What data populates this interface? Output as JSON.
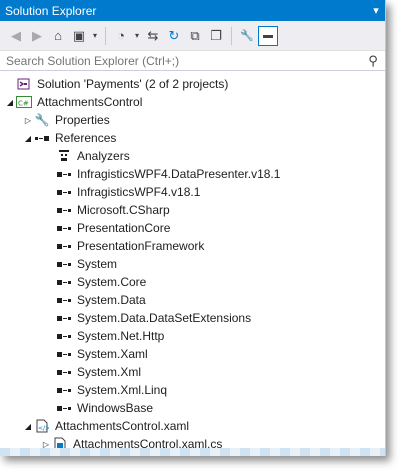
{
  "window": {
    "title": "Solution Explorer",
    "pin_glyph": "▾"
  },
  "toolbar": {
    "buttons": [
      {
        "name": "back-icon",
        "glyph": "◀"
      },
      {
        "name": "forward-icon",
        "glyph": "▶"
      },
      {
        "name": "home-icon",
        "glyph": "⌂"
      },
      {
        "name": "switch-views-icon",
        "glyph": "▣"
      },
      {
        "name": "switch-views-dropdown-icon",
        "glyph": "▾"
      },
      {
        "name": "pending-changes-filter-icon",
        "glyph": "◔"
      },
      {
        "name": "pending-changes-dropdown-icon",
        "glyph": "▾"
      },
      {
        "name": "sync-icon",
        "glyph": "⇆"
      },
      {
        "name": "refresh-icon",
        "glyph": "↻"
      },
      {
        "name": "collapse-all-icon",
        "glyph": "⧉"
      },
      {
        "name": "show-all-files-icon",
        "glyph": "❐"
      },
      {
        "name": "properties-icon",
        "glyph": "🔧"
      },
      {
        "name": "preview-selected-icon",
        "glyph": "▬"
      }
    ]
  },
  "search": {
    "placeholder": "Search Solution Explorer (Ctrl+;)"
  },
  "tree": {
    "solution": "Solution 'Payments' (2 of 2 projects)",
    "project": "AttachmentsControl",
    "properties": "Properties",
    "references": "References",
    "reference_items": [
      "Analyzers",
      "InfragisticsWPF4.DataPresenter.v18.1",
      "InfragisticsWPF4.v18.1",
      "Microsoft.CSharp",
      "PresentationCore",
      "PresentationFramework",
      "System",
      "System.Core",
      "System.Data",
      "System.Data.DataSetExtensions",
      "System.Net.Http",
      "System.Xaml",
      "System.Xml",
      "System.Xml.Linq",
      "WindowsBase"
    ],
    "xaml_file": "AttachmentsControl.xaml",
    "xaml_cs_file": "AttachmentsControl.xaml.cs"
  },
  "colors": {
    "accent": "#007acc",
    "toolbar_bg": "#eeeef2",
    "text": "#1e1e1e"
  }
}
